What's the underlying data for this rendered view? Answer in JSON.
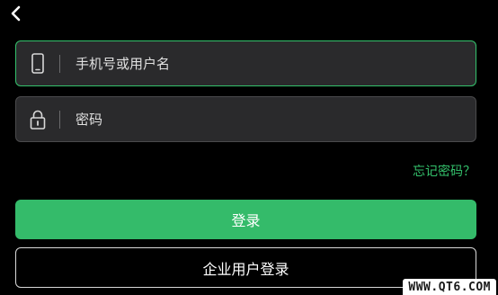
{
  "header": {
    "back_icon": "chevron-left-icon"
  },
  "form": {
    "username": {
      "icon": "phone-icon",
      "placeholder": "手机号或用户名",
      "value": ""
    },
    "password": {
      "icon": "lock-icon",
      "placeholder": "密码",
      "value": ""
    },
    "forgot_label": "忘记密码？",
    "login_label": "登录",
    "enterprise_label": "企业用户登录"
  },
  "colors": {
    "accent": "#34bb6a",
    "background": "#000000",
    "field_background": "#2a2a2c"
  },
  "watermark": {
    "text": "WWW.QT6.COM"
  }
}
